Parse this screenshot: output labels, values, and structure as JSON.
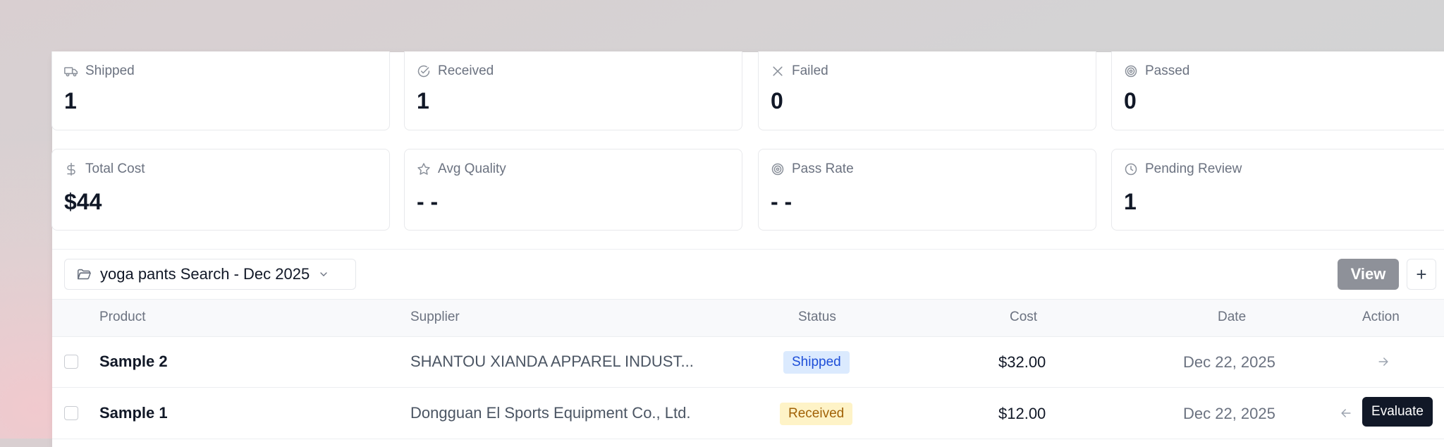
{
  "stats_row1": [
    {
      "icon": "truck-icon",
      "label": "Shipped",
      "value": "1"
    },
    {
      "icon": "check-circle-icon",
      "label": "Received",
      "value": "1"
    },
    {
      "icon": "x-icon",
      "label": "Failed",
      "value": "0"
    },
    {
      "icon": "target-icon",
      "label": "Passed",
      "value": "0"
    }
  ],
  "stats_row2": [
    {
      "icon": "dollar-icon",
      "label": "Total Cost",
      "value": "$44"
    },
    {
      "icon": "star-icon",
      "label": "Avg Quality",
      "value": "- -"
    },
    {
      "icon": "target-icon",
      "label": "Pass Rate",
      "value": "- -"
    },
    {
      "icon": "clock-icon",
      "label": "Pending Review",
      "value": "1"
    }
  ],
  "toolbar": {
    "folder_label": "yoga pants Search - Dec 2025",
    "view_label": "View",
    "add_label": "+"
  },
  "table": {
    "headers": [
      "Product",
      "Supplier",
      "Status",
      "Cost",
      "Date",
      "Action"
    ],
    "rows": [
      {
        "product": "Sample 2",
        "supplier": "SHANTOU XIANDA APPAREL INDUST...",
        "status": "Shipped",
        "cost": "$32.00",
        "date": "Dec 22, 2025"
      },
      {
        "product": "Sample 1",
        "supplier": "Dongguan El Sports Equipment Co., Ltd.",
        "status": "Received",
        "cost": "$12.00",
        "date": "Dec 22, 2025"
      }
    ]
  },
  "tooltip": {
    "label": "Evaluate"
  },
  "colors": {
    "shipped_bg": "#dbeafe",
    "shipped_text": "#1d4ed8",
    "received_bg": "#fef3c7",
    "received_text": "#a16207",
    "view_button": "#8e9199"
  }
}
